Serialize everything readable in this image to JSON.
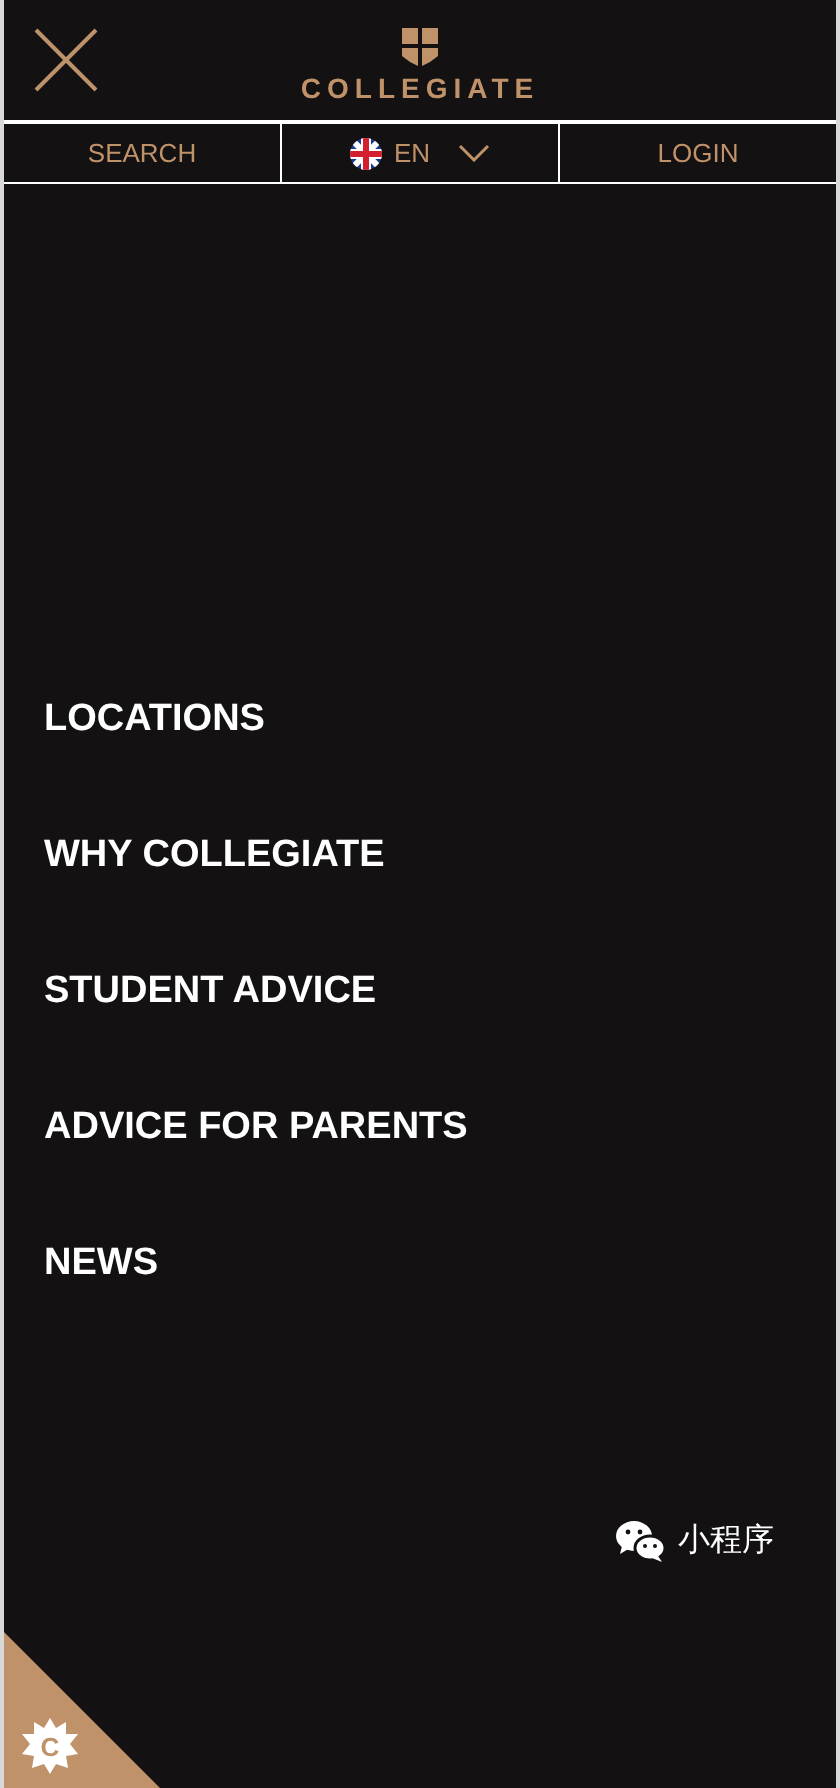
{
  "header": {
    "brand": "COLLEGIATE"
  },
  "nav": [
    {
      "kind": "link",
      "label": "SEARCH"
    },
    {
      "kind": "language",
      "label": "EN"
    },
    {
      "kind": "link",
      "label": "LOGIN"
    }
  ],
  "menu": [
    {
      "label": "LOCATIONS"
    },
    {
      "label": "WHY COLLEGIATE"
    },
    {
      "label": "STUDENT ADVICE"
    },
    {
      "label": "ADVICE FOR PARENTS"
    },
    {
      "label": "NEWS"
    }
  ],
  "mini_program": {
    "label": "小程序"
  },
  "cookie_badge": {
    "label": "C"
  }
}
